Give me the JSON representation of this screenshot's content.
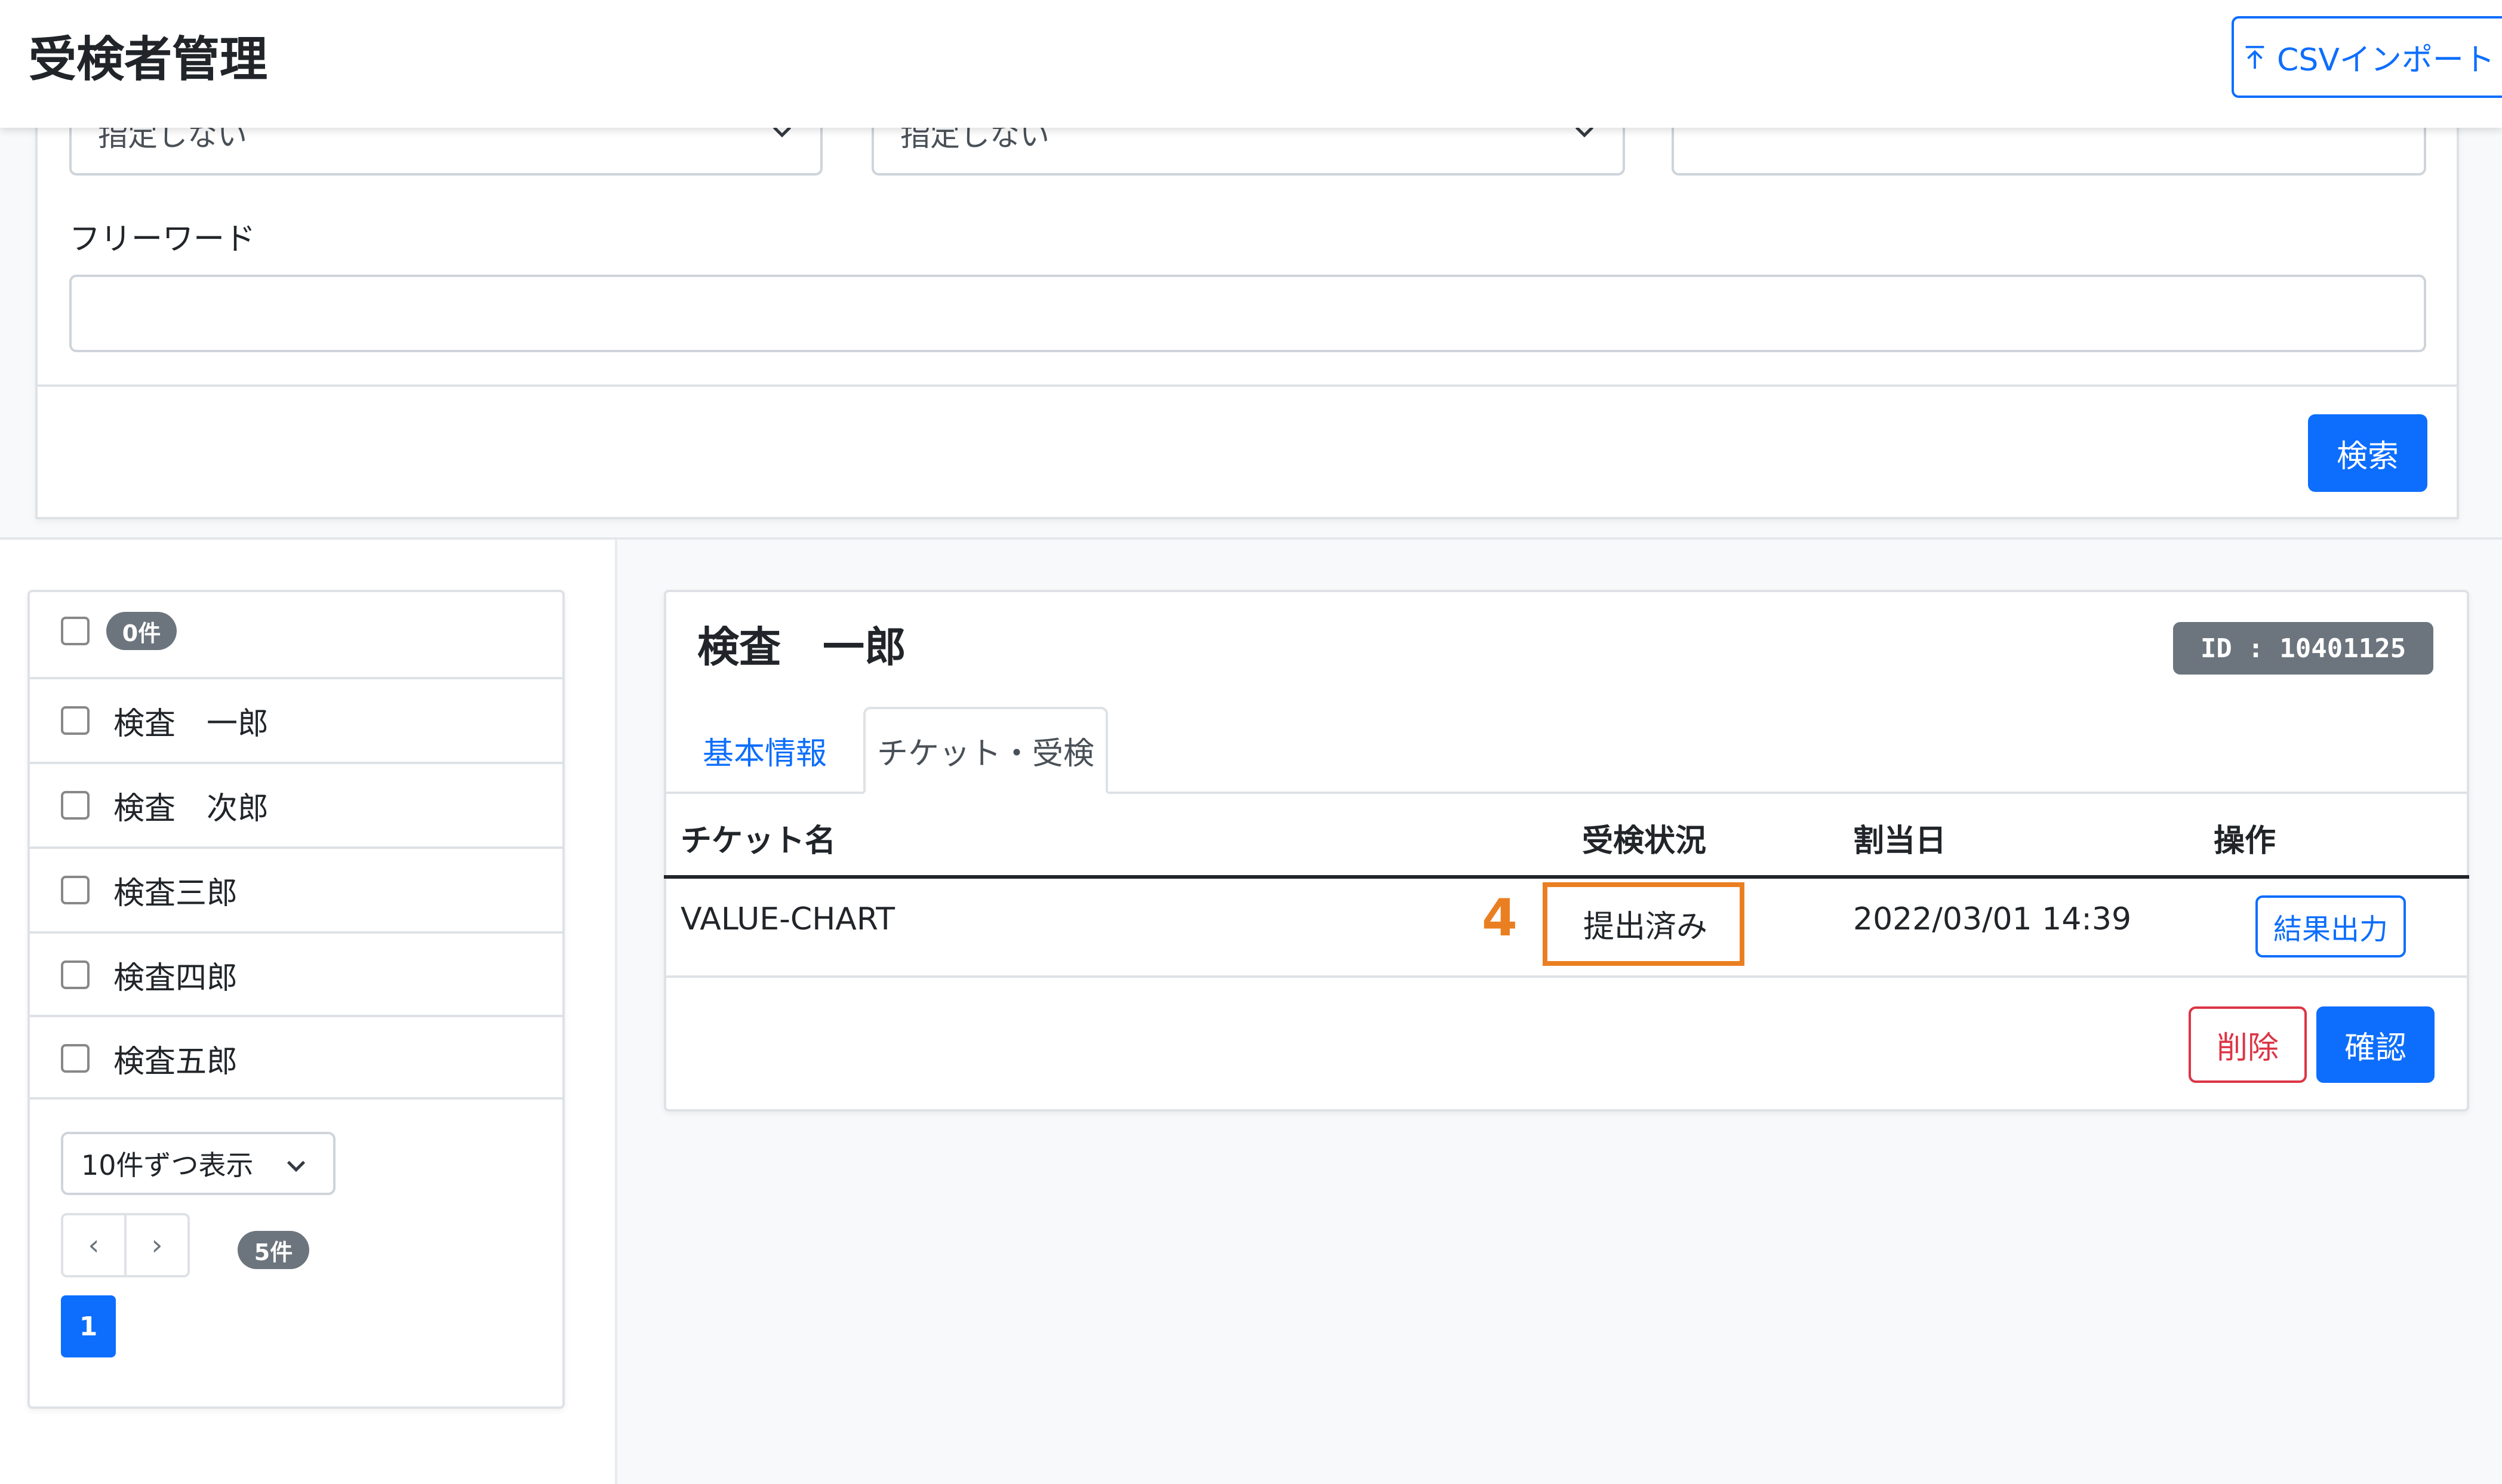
{
  "header": {
    "title": "受検者管理",
    "csv_import_label": "CSVインポート"
  },
  "search": {
    "select1_value": "指定しない",
    "select2_value": "指定しない",
    "freeword_label": "フリーワード",
    "search_button": "検索"
  },
  "list": {
    "select_all_count": "0件",
    "items": [
      {
        "name": "検査　一郎"
      },
      {
        "name": "検査　次郎"
      },
      {
        "name": "検査三郎"
      },
      {
        "name": "検査四郎"
      },
      {
        "name": "検査五郎"
      }
    ],
    "page_size_label": "10件ずつ表示",
    "prev_label": "‹",
    "next_label": "›",
    "total_count": "5件",
    "current_page": "1"
  },
  "detail": {
    "title": "検査　一郎",
    "id_badge": "ID : 10401125",
    "tabs": [
      "基本情報",
      "チケット・受検"
    ],
    "table": {
      "headers": [
        "チケット名",
        "受検状況",
        "割当日",
        "操作"
      ],
      "rows": [
        {
          "ticket": "VALUE-CHART",
          "status": "提出済み",
          "assigned": "2022/03/01 14:39",
          "action": "結果出力"
        }
      ]
    },
    "delete_button": "削除",
    "confirm_button": "確認",
    "annotation": "4"
  },
  "colors": {
    "primary": "#0d6efd",
    "danger": "#dc3545",
    "highlight": "#ea7f22",
    "badge": "#6c757d"
  }
}
